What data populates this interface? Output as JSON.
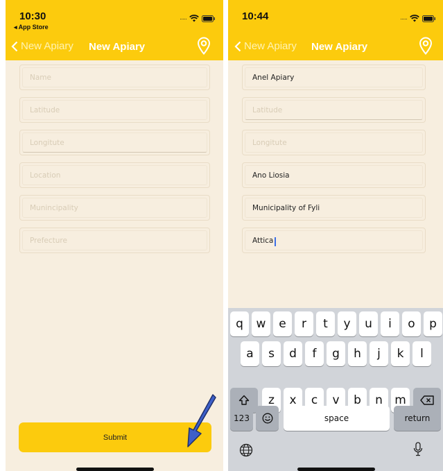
{
  "left_screen": {
    "status": {
      "time": "10:30",
      "breadcrumb": "◂ App Store"
    },
    "nav": {
      "back_label": "New Apiary",
      "title": "New Apiary"
    },
    "fields": [
      {
        "placeholder": "Name",
        "value": ""
      },
      {
        "placeholder": "Latitude",
        "value": ""
      },
      {
        "placeholder": "Longitute",
        "value": ""
      },
      {
        "placeholder": "Location",
        "value": ""
      },
      {
        "placeholder": "Munincipality",
        "value": ""
      },
      {
        "placeholder": "Prefecture",
        "value": ""
      }
    ],
    "submit_label": "Submit",
    "annotation_arrow_color": "#3d5fc9"
  },
  "right_screen": {
    "status": {
      "time": "10:44"
    },
    "nav": {
      "back_label": "New Apiary",
      "title": "New Apiary"
    },
    "fields": [
      {
        "placeholder": "Name",
        "value": "Anel Apiary"
      },
      {
        "placeholder": "Latitude",
        "value": ""
      },
      {
        "placeholder": "Longitute",
        "value": ""
      },
      {
        "placeholder": "Location",
        "value": "Ano Liosia"
      },
      {
        "placeholder": "Munincipality",
        "value": "Municipality of Fyli"
      },
      {
        "placeholder": "Prefecture",
        "value": "Attica"
      }
    ],
    "keyboard": {
      "row1": [
        "q",
        "w",
        "e",
        "r",
        "t",
        "y",
        "u",
        "i",
        "o",
        "p"
      ],
      "row2": [
        "a",
        "s",
        "d",
        "f",
        "g",
        "h",
        "j",
        "k",
        "l"
      ],
      "row3": [
        "z",
        "x",
        "c",
        "v",
        "b",
        "n",
        "m"
      ],
      "numbers_label": "123",
      "space_label": "space",
      "return_label": "return"
    }
  },
  "icons": {
    "back": "chevron-left-icon",
    "location": "location-pin-icon",
    "wifi": "wifi-icon",
    "battery": "battery-icon",
    "shift": "shift-icon",
    "delete": "delete-icon",
    "emoji": "emoji-icon",
    "globe": "globe-icon",
    "mic": "microphone-icon"
  },
  "colors": {
    "header": "#fccb0d",
    "background": "#f7eedf",
    "button": "#fccb0d",
    "keyboard": "#d1d4d9",
    "caret": "#3b6ee6"
  }
}
